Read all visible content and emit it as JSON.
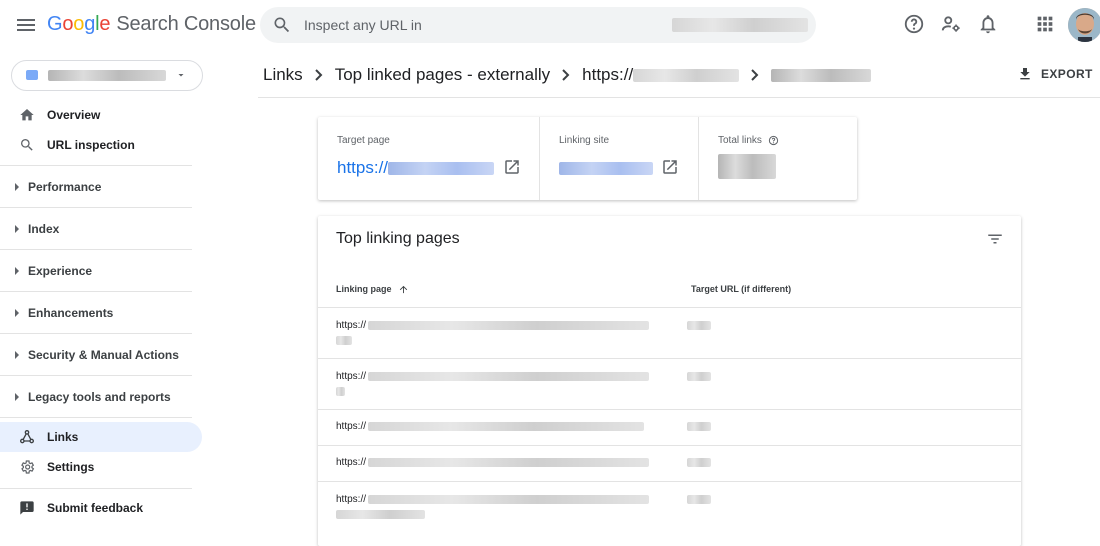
{
  "app": {
    "name_letters": [
      "G",
      "o",
      "o",
      "g",
      "l",
      "e"
    ],
    "product": "Search Console"
  },
  "search": {
    "placeholder": "Inspect any URL in"
  },
  "topbar": {
    "icons": [
      "help-icon",
      "manage-users-icon",
      "notifications-icon",
      "apps-grid-icon",
      "account-avatar"
    ]
  },
  "sidebar": {
    "top_items": [
      {
        "label": "Overview",
        "icon": "home-icon"
      },
      {
        "label": "URL inspection",
        "icon": "search-icon"
      }
    ],
    "groups": [
      {
        "label": "Performance"
      },
      {
        "label": "Index"
      },
      {
        "label": "Experience"
      },
      {
        "label": "Enhancements"
      },
      {
        "label": "Security & Manual Actions"
      },
      {
        "label": "Legacy tools and reports"
      }
    ],
    "bottom_items": [
      {
        "label": "Links",
        "icon": "links-icon",
        "active": true
      },
      {
        "label": "Settings",
        "icon": "gear-icon"
      }
    ],
    "feedback": {
      "label": "Submit feedback",
      "icon": "feedback-icon"
    }
  },
  "breadcrumb": {
    "items": [
      "Links",
      "Top linked pages - externally",
      "https://"
    ]
  },
  "export": {
    "label": "EXPORT"
  },
  "summary": {
    "target_page": {
      "label": "Target page",
      "value_prefix": "https://"
    },
    "linking_site": {
      "label": "Linking site"
    },
    "total_links": {
      "label": "Total links"
    }
  },
  "table": {
    "title": "Top linking pages",
    "columns": {
      "linking_page": "Linking page",
      "target_url": "Target URL (if different)"
    },
    "sort": "ascending",
    "rows": [
      {
        "linking_page": "https://"
      },
      {
        "linking_page": "https://"
      },
      {
        "linking_page": "https://"
      },
      {
        "linking_page": "https://"
      },
      {
        "linking_page": "https://"
      }
    ]
  },
  "colors": {
    "accent": "#1a73e8",
    "active_nav_bg": "#e8f0fe",
    "search_bg": "#f1f3f4"
  }
}
